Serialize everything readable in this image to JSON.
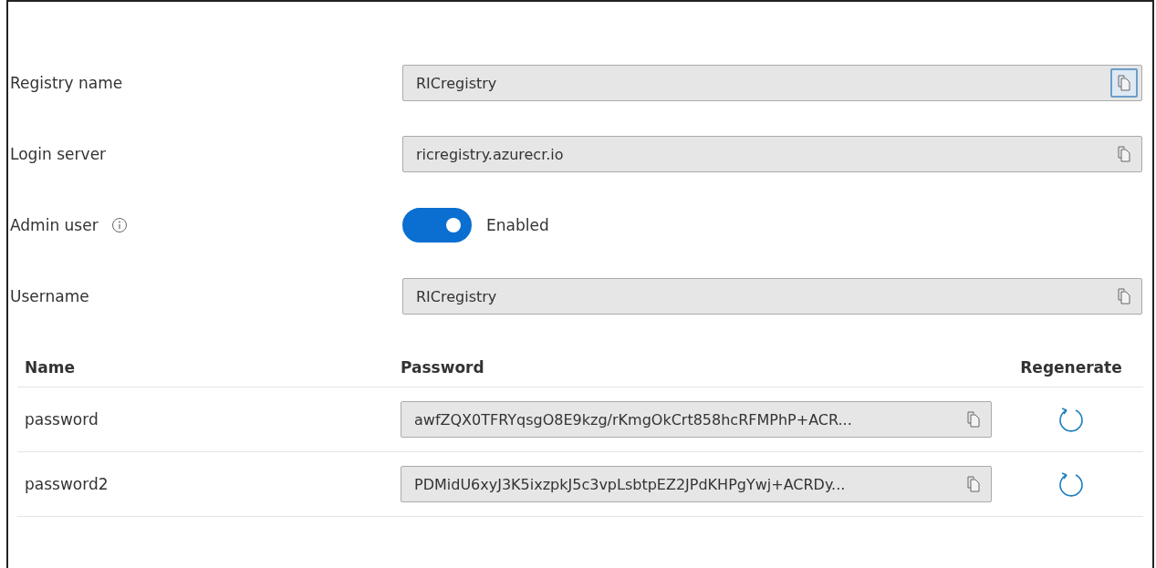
{
  "fields": [
    {
      "kind": "text",
      "label": "Registry name",
      "value": "RICregistry",
      "copy_focused": true
    },
    {
      "kind": "text",
      "label": "Login server",
      "value": "ricregistry.azurecr.io",
      "copy_focused": false
    },
    {
      "kind": "toggle",
      "label": "Admin user",
      "info": true,
      "on": true,
      "state_text": "Enabled"
    },
    {
      "kind": "text",
      "label": "Username",
      "value": "RICregistry",
      "copy_focused": false
    }
  ],
  "passwords": {
    "columns": [
      "Name",
      "Password",
      "Regenerate"
    ],
    "rows": [
      {
        "name": "password",
        "value": "awfZQX0TFRYqsgO8E9kzg/rKmgOkCrt858hcRFMPhP+ACR..."
      },
      {
        "name": "password2",
        "value": "PDMidU6xyJ3K5ixzpkJ5c3vpLsbtpEZ2JPdKHPgYwj+ACRDy..."
      }
    ]
  }
}
